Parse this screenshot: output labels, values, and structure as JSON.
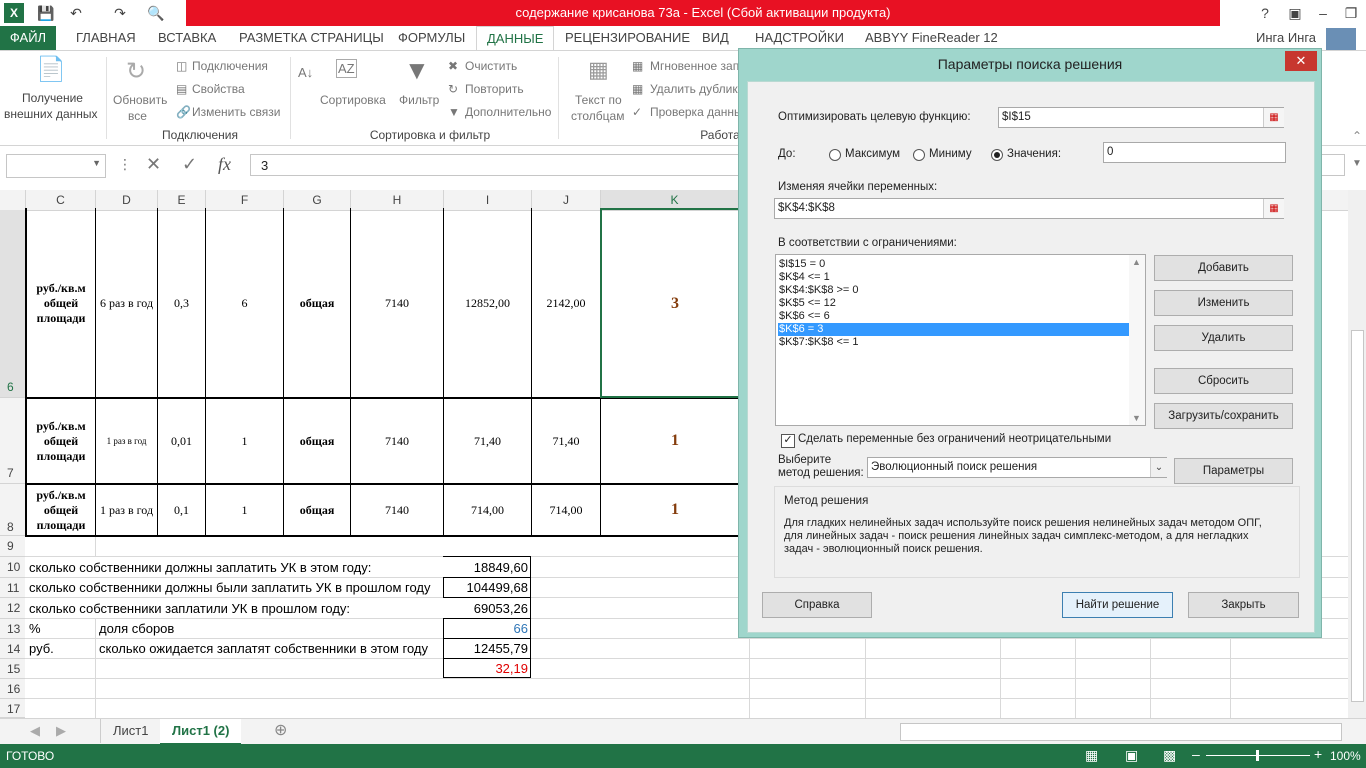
{
  "window": {
    "title": "содержание крисанова 73а -  Excel (Сбой активации продукта)",
    "user": "Инга Инга"
  },
  "tabs": [
    "ФАЙЛ",
    "ГЛАВНАЯ",
    "ВСТАВКА",
    "РАЗМЕТКА СТРАНИЦЫ",
    "ФОРМУЛЫ",
    "ДАННЫЕ",
    "РЕЦЕНЗИРОВАНИЕ",
    "ВИД",
    "НАДСТРОЙКИ",
    "ABBYY FineReader 12"
  ],
  "ribbon": {
    "get_external_1": "Получение",
    "get_external_2": "внешних данных",
    "refresh_1": "Обновить",
    "refresh_2": "все",
    "connections": "Подключения",
    "properties": "Свойства",
    "edit_links": "Изменить связи",
    "group_connections": "Подключения",
    "sort": "Сортировка",
    "filter": "Фильтр",
    "clear": "Очистить",
    "reapply": "Повторить",
    "advanced": "Дополнительно",
    "group_sort": "Сортировка и фильтр",
    "text_to_cols_1": "Текст по",
    "text_to_cols_2": "столбцам",
    "flash_fill": "Мгновенное запо",
    "remove_dup": "Удалить дублика",
    "validation": "Проверка данны",
    "group_tools": "Работа"
  },
  "formula_bar": {
    "value": "3",
    "fx": "fx"
  },
  "columns": [
    "C",
    "D",
    "E",
    "F",
    "G",
    "H",
    "I",
    "J",
    "K"
  ],
  "rows": {
    "r6": {
      "num": "6",
      "c": "руб./кв.м общей площади",
      "d": "6 раз в год",
      "e": "0,3",
      "f": "6",
      "g": "общая",
      "h": "7140",
      "i": "12852,00",
      "j": "2142,00",
      "k": "3"
    },
    "r7": {
      "num": "7",
      "c": "руб./кв.м общей площади",
      "d": "1 раз в год",
      "e": "0,01",
      "f": "1",
      "g": "общая",
      "h": "7140",
      "i": "71,40",
      "j": "71,40",
      "k": "1"
    },
    "r8": {
      "num": "8",
      "c": "руб./кв.м общей площади",
      "d": "1 раз в год",
      "e": "0,1",
      "f": "1",
      "g": "общая",
      "h": "7140",
      "i": "714,00",
      "j": "714,00",
      "k": "1"
    },
    "r9": {
      "num": "9"
    },
    "r10": {
      "num": "10",
      "label": "сколько собственники должны заплатить УК в этом году:",
      "value": "18849,60"
    },
    "r11": {
      "num": "11",
      "label": "сколько собственники должны были заплатить УК в прошлом году",
      "value": "104499,68"
    },
    "r12": {
      "num": "12",
      "label": "сколько собственники заплатили УК в прошлом году:",
      "value": "69053,26"
    },
    "r13": {
      "num": "13",
      "c": "%",
      "d": "доля сборов",
      "value": "66"
    },
    "r14": {
      "num": "14",
      "c": "руб.",
      "d": "сколько ожидается заплатят собственники в этом году",
      "value": "12455,79"
    },
    "r15": {
      "num": "15",
      "value": "32,19"
    },
    "r16": {
      "num": "16"
    },
    "r17": {
      "num": "17"
    }
  },
  "sheets": [
    "Лист1",
    "Лист1 (2)"
  ],
  "status": {
    "ready": "ГОТОВО",
    "zoom": "100%"
  },
  "dialog": {
    "title": "Параметры поиска решения",
    "objective_label": "Оптимизировать целевую функцию:",
    "objective_value": "$I$15",
    "to_label": "До:",
    "opt_max": "Максимум",
    "opt_min": "Миниму",
    "opt_value": "Значения:",
    "value_of": "0",
    "changing_label": "Изменяя ячейки переменных:",
    "changing_value": "$K$4:$K$8",
    "constraints_label": "В соответствии с ограничениями:",
    "constraints": [
      "$I$15 = 0",
      "$K$4 <= 1",
      "$K$4:$K$8 >= 0",
      "$K$5 <= 12",
      "$K$6 <= 6",
      "$K$6 = 3",
      "$K$7:$K$8 <= 1"
    ],
    "btn_add": "Добавить",
    "btn_change": "Изменить",
    "btn_delete": "Удалить",
    "btn_reset": "Сбросить",
    "btn_load": "Загрузить/сохранить",
    "nonneg_label": "Сделать переменные без ограничений неотрицательными",
    "method_label_1": "Выберите",
    "method_label_2": "метод решения:",
    "method_value": "Эволюционный поиск решения",
    "btn_options": "Параметры",
    "method_group": "Метод решения",
    "method_desc": "Для гладких нелинейных задач используйте поиск решения нелинейных задач методом ОПГ, для линейных задач - поиск решения линейных задач симплекс-методом, а для негладких задач - эволюционный поиск решения.",
    "btn_help": "Справка",
    "btn_solve": "Найти решение",
    "btn_close": "Закрыть"
  }
}
